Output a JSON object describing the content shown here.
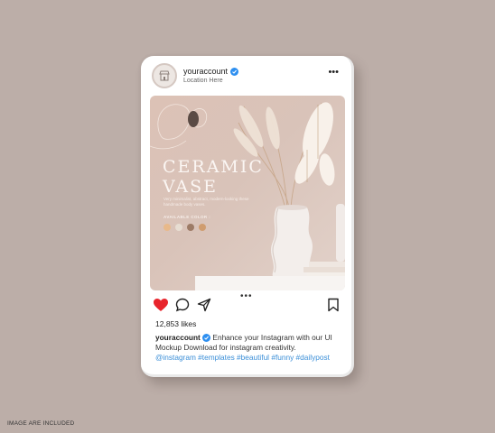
{
  "post": {
    "username": "youraccount",
    "location": "Location Here",
    "likes": "12,853 likes",
    "caption_user": "youraccount",
    "caption_text": "Enhance your Instagram with our UI Mockup Download for instagram creativity.",
    "hashtags": "@instagram #templates #beautiful #funny #dailypost"
  },
  "image": {
    "title_line1": "CERAMIC",
    "title_line2": "VASE",
    "description": "Very minimalist, abstract, modern-looking these handmade body vases.",
    "available_label": "AVAILABLE COLOR :",
    "swatches": [
      "#e8b98a",
      "#e7ddd2",
      "#9d7b66",
      "#cf9c6f"
    ]
  },
  "icons": {
    "avatar": "storefront-icon",
    "verified": "verified-badge-icon",
    "more": "more-options-icon",
    "like": "heart-icon",
    "comment": "comment-icon",
    "share": "share-icon",
    "save": "bookmark-icon"
  },
  "colors": {
    "background": "#bcaea8",
    "heart": "#e8242c",
    "hashtag": "#3b8fd8",
    "verified": "#2d8ff0"
  },
  "footer": {
    "note": "IMAGE ARE INCLUDED"
  }
}
